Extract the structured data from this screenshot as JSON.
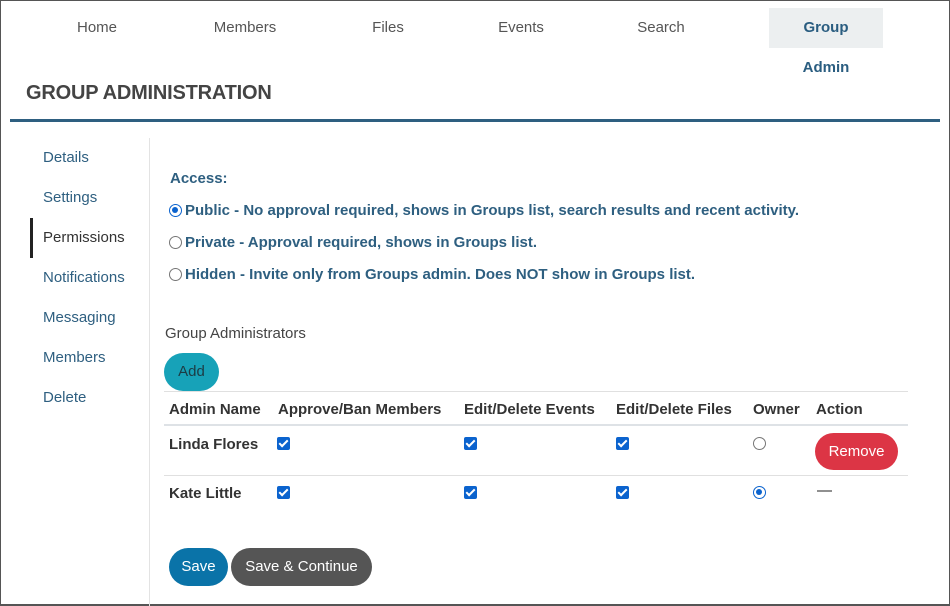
{
  "topnav": {
    "tabs": [
      {
        "label": "Home"
      },
      {
        "label": "Members"
      },
      {
        "label": "Files"
      },
      {
        "label": "Events"
      },
      {
        "label": "Search"
      },
      {
        "label": "Group Admin",
        "active": true
      }
    ]
  },
  "page": {
    "title": "GROUP ADMINISTRATION"
  },
  "sidebar": {
    "items": [
      {
        "label": "Details"
      },
      {
        "label": "Settings"
      },
      {
        "label": "Permissions",
        "active": true
      },
      {
        "label": "Notifications"
      },
      {
        "label": "Messaging"
      },
      {
        "label": "Members"
      },
      {
        "label": "Delete"
      }
    ]
  },
  "access": {
    "label": "Access:",
    "options": [
      {
        "label": "Public - No approval required, shows in Groups list, search results and recent activity.",
        "selected": true
      },
      {
        "label": "Private - Approval required, shows in Groups list.",
        "selected": false
      },
      {
        "label": "Hidden - Invite only from Groups admin. Does NOT show in Groups list.",
        "selected": false
      }
    ]
  },
  "admins": {
    "section_label": "Group Administrators",
    "add_label": "Add",
    "columns": [
      "Admin Name",
      "Approve/Ban Members",
      "Edit/Delete Events",
      "Edit/Delete Files",
      "Owner",
      "Action"
    ],
    "rows": [
      {
        "name": "Linda Flores",
        "approve_ban": true,
        "edit_events": true,
        "edit_files": true,
        "owner": false,
        "action": "Remove"
      },
      {
        "name": "Kate Little",
        "approve_ban": true,
        "edit_events": true,
        "edit_files": true,
        "owner": true,
        "action": "—"
      }
    ]
  },
  "footer": {
    "save_label": "Save",
    "save_continue_label": "Save & Continue"
  },
  "colors": {
    "primary": "#2e5f80",
    "add_button": "#17a2b8",
    "remove_button": "#dc3545",
    "save_button": "#0a73a8",
    "save_continue_button": "#555555",
    "checkbox": "#0b63ce"
  }
}
